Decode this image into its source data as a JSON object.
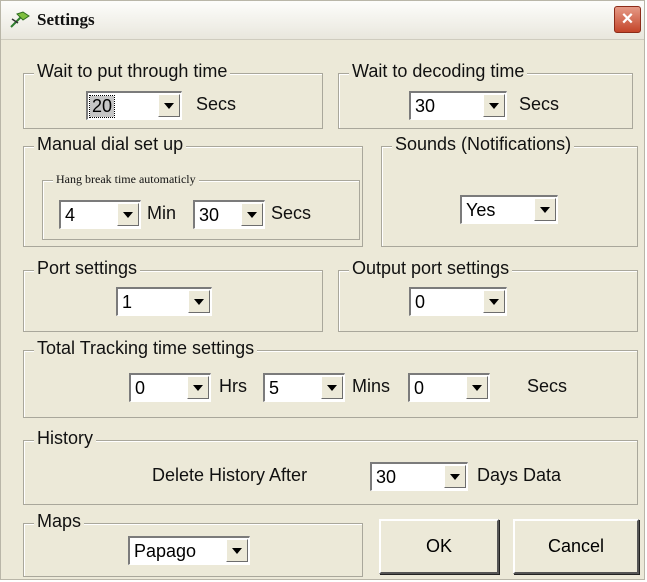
{
  "window": {
    "title": "Settings",
    "close_label": "×"
  },
  "groups": {
    "wait_put_through": {
      "legend": "Wait to put through time",
      "value": "20",
      "unit": "Secs"
    },
    "wait_decoding": {
      "legend": "Wait to decoding time",
      "value": "30",
      "unit": "Secs"
    },
    "manual_dial": {
      "legend": "Manual dial set up",
      "hang_break": {
        "legend": "Hang break time automaticly",
        "min_value": "4",
        "min_unit": "Min",
        "sec_value": "30",
        "sec_unit": "Secs"
      }
    },
    "sounds": {
      "legend": "Sounds (Notifications)",
      "value": "Yes"
    },
    "port": {
      "legend": "Port settings",
      "value": "1"
    },
    "output_port": {
      "legend": "Output port settings",
      "value": "0"
    },
    "total_tracking": {
      "legend": "Total Tracking time settings",
      "hrs_value": "0",
      "hrs_unit": "Hrs",
      "mins_value": "5",
      "mins_unit": "Mins",
      "secs_value": "0",
      "secs_unit": "Secs"
    },
    "history": {
      "legend": "History",
      "prefix": "Delete History After",
      "value": "30",
      "suffix": "Days Data"
    },
    "maps": {
      "legend": "Maps",
      "value": "Papago"
    }
  },
  "buttons": {
    "ok": "OK",
    "cancel": "Cancel"
  }
}
